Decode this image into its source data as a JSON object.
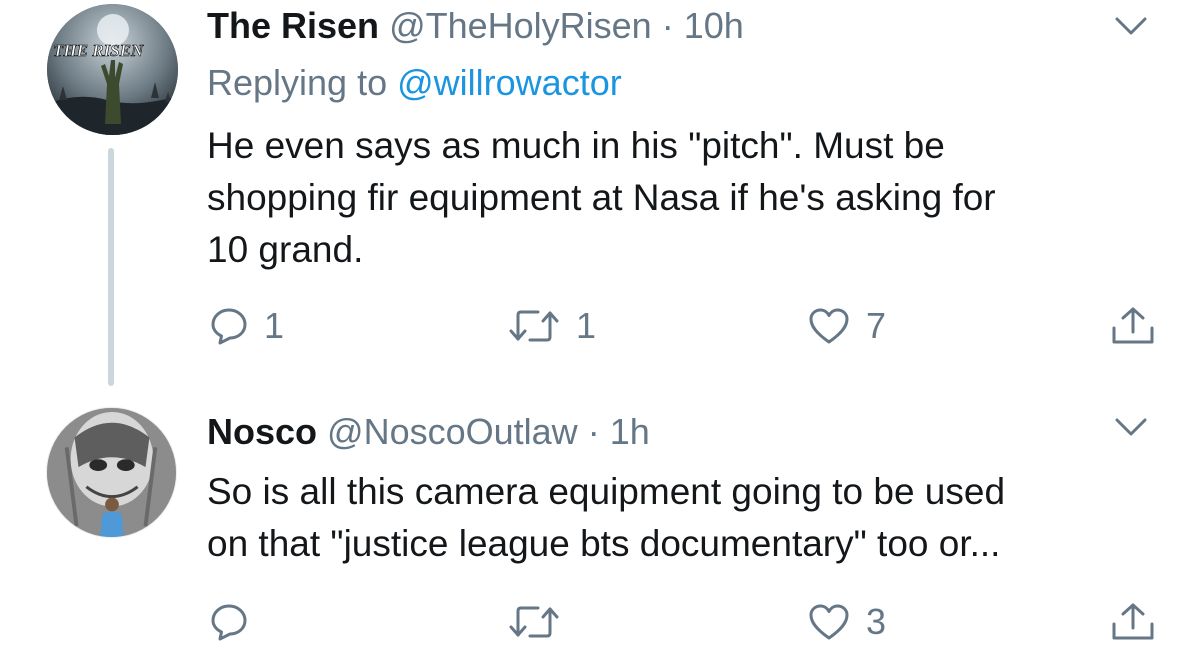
{
  "tweets": [
    {
      "display_name": "The Risen",
      "handle": "@TheHolyRisen",
      "separator": "·",
      "time": "10h",
      "avatar_icon": "the-risen-logo",
      "avatar_text": "THE RISEN",
      "replying_label": "Replying to",
      "replying_to": "@willrowactor",
      "body_lines": [
        "He even says as much in his \"pitch\". Must be",
        "shopping fir equipment at Nasa if he's asking for",
        "10 grand."
      ],
      "reply_count": "1",
      "retweet_count": "1",
      "like_count": "7"
    },
    {
      "display_name": "Nosco",
      "handle": "@NoscoOutlaw",
      "separator": "·",
      "time": "1h",
      "avatar_icon": "mural-photo",
      "body_lines": [
        "So is all this camera equipment going to be used",
        "on that \"justice league bts documentary\" too or..."
      ],
      "reply_count": "",
      "retweet_count": "",
      "like_count": "3"
    }
  ],
  "icons": {
    "reply": "reply-icon",
    "retweet": "retweet-icon",
    "like": "heart-icon",
    "share": "share-icon",
    "menu": "chevron-down-icon"
  },
  "colors": {
    "text": "#14171a",
    "secondary": "#657786",
    "link": "#1b95e0",
    "thread_line": "#ccd6dd"
  }
}
